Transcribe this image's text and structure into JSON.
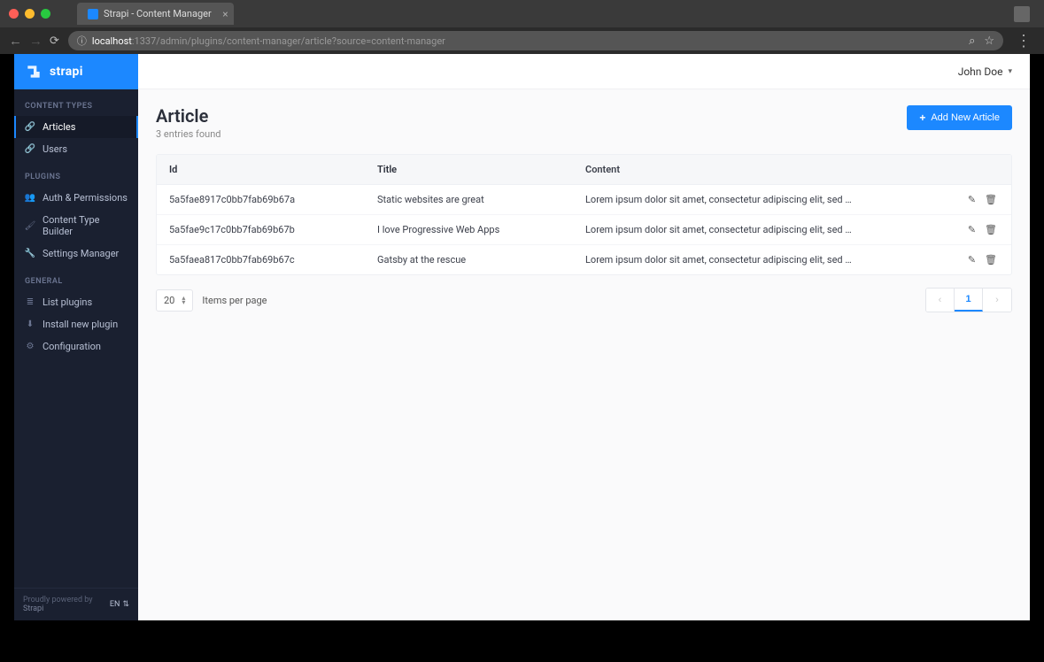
{
  "browser": {
    "tab_title": "Strapi - Content Manager",
    "url_host": "localhost",
    "url_port": ":1337",
    "url_path": "/admin/plugins/content-manager/article?source=content-manager"
  },
  "brand": {
    "name": "strapi"
  },
  "sidebar": {
    "sections": {
      "content_types": {
        "title": "Content Types",
        "items": [
          {
            "label": "Articles",
            "icon": "link-icon",
            "active": true
          },
          {
            "label": "Users",
            "icon": "link-icon",
            "active": false
          }
        ]
      },
      "plugins": {
        "title": "Plugins",
        "items": [
          {
            "label": "Auth & Permissions",
            "icon": "users-icon"
          },
          {
            "label": "Content Type Builder",
            "icon": "brush-icon"
          },
          {
            "label": "Settings Manager",
            "icon": "wrench-icon"
          }
        ]
      },
      "general": {
        "title": "General",
        "items": [
          {
            "label": "List plugins",
            "icon": "list-icon"
          },
          {
            "label": "Install new plugin",
            "icon": "download-icon"
          },
          {
            "label": "Configuration",
            "icon": "gear-icon"
          }
        ]
      }
    },
    "footer": {
      "powered_by": "Proudly powered by ",
      "powered_by_link": "Strapi",
      "lang": "EN"
    }
  },
  "topbar": {
    "user_name": "John Doe"
  },
  "page": {
    "title": "Article",
    "subtitle": "3 entries found",
    "add_button": "Add New Article"
  },
  "table": {
    "columns": {
      "id": "Id",
      "title": "Title",
      "content": "Content"
    },
    "rows": [
      {
        "id": "5a5fae8917c0bb7fab69b67a",
        "title": "Static websites are great",
        "content": "Lorem ipsum dolor sit amet, consectetur adipiscing elit, sed …"
      },
      {
        "id": "5a5fae9c17c0bb7fab69b67b",
        "title": "I love Progressive Web Apps",
        "content": "Lorem ipsum dolor sit amet, consectetur adipiscing elit, sed …"
      },
      {
        "id": "5a5faea817c0bb7fab69b67c",
        "title": "Gatsby at the rescue",
        "content": "Lorem ipsum dolor sit amet, consectetur adipiscing elit, sed …"
      }
    ]
  },
  "pagination": {
    "per_page_value": "20",
    "per_page_label": "Items per page",
    "current_page": "1"
  }
}
